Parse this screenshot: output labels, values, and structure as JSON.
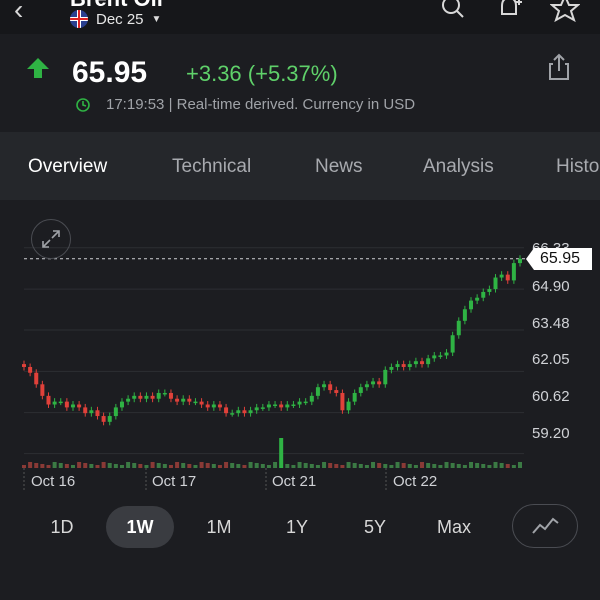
{
  "header": {
    "title": "Brent Oil",
    "contract": "Dec 25",
    "icons": [
      "back-icon",
      "search-icon",
      "add-alert-icon",
      "star-icon"
    ]
  },
  "quote": {
    "price": "65.95",
    "change": "+3.36 (+5.37%)",
    "time": "17:19:53",
    "status_text": "| Real-time derived. Currency in USD",
    "up_color": "#2fb344",
    "change_color": "#5fd16a"
  },
  "tabs": [
    {
      "label": "Overview",
      "active": true
    },
    {
      "label": "Technical",
      "active": false
    },
    {
      "label": "News",
      "active": false
    },
    {
      "label": "Analysis",
      "active": false
    },
    {
      "label": "Histo",
      "active": false
    }
  ],
  "chart": {
    "price_tag": "65.95",
    "y_ticks": [
      "66.33",
      "64.90",
      "63.48",
      "62.05",
      "60.62",
      "59.20"
    ],
    "x_labels": [
      "Oct 16",
      "Oct 17",
      "Oct 21",
      "Oct 22"
    ]
  },
  "chart_data": {
    "type": "line",
    "x_labels": [
      "Oct 16",
      "Oct 17",
      "Oct 21",
      "Oct 22"
    ],
    "y_ticks": [
      66.33,
      64.9,
      63.48,
      62.05,
      60.62,
      59.2
    ],
    "ylim": [
      58.7,
      66.6
    ],
    "last_price": 65.95,
    "grid": true,
    "closes": [
      62.2,
      62.0,
      61.6,
      61.2,
      60.9,
      61.0,
      61.0,
      60.8,
      60.9,
      60.8,
      60.6,
      60.7,
      60.5,
      60.3,
      60.5,
      60.8,
      61.0,
      61.1,
      61.2,
      61.1,
      61.2,
      61.1,
      61.3,
      61.3,
      61.1,
      61.0,
      61.1,
      61.0,
      61.0,
      60.9,
      60.8,
      60.9,
      60.8,
      60.6,
      60.6,
      60.7,
      60.6,
      60.7,
      60.8,
      60.8,
      60.9,
      60.9,
      60.8,
      60.9,
      60.9,
      61.0,
      61.0,
      61.2,
      61.5,
      61.6,
      61.4,
      61.3,
      60.7,
      61.0,
      61.3,
      61.5,
      61.6,
      61.7,
      61.6,
      62.1,
      62.2,
      62.3,
      62.2,
      62.3,
      62.4,
      62.3,
      62.5,
      62.6,
      62.6,
      62.7,
      63.3,
      63.8,
      64.2,
      64.5,
      64.6,
      64.8,
      64.9,
      65.3,
      65.4,
      65.2,
      65.8,
      65.95
    ]
  },
  "periods": [
    {
      "label": "1D",
      "active": false
    },
    {
      "label": "1W",
      "active": true
    },
    {
      "label": "1M",
      "active": false
    },
    {
      "label": "1Y",
      "active": false
    },
    {
      "label": "5Y",
      "active": false
    },
    {
      "label": "Max",
      "active": false
    }
  ]
}
